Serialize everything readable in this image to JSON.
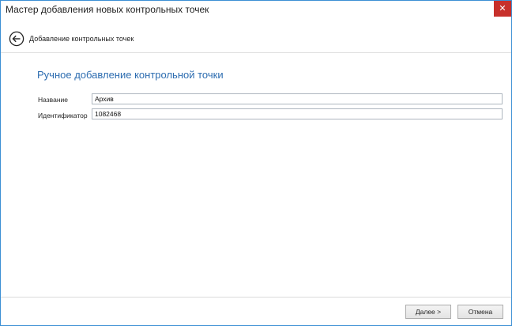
{
  "window": {
    "title": "Мастер добавления новых контрольных точек",
    "close_glyph": "✕"
  },
  "nav": {
    "back_icon": "back-arrow-circle-icon",
    "title": "Добавление контрольных точек"
  },
  "page": {
    "heading": "Ручное добавление контрольной точки"
  },
  "form": {
    "name_label": "Название",
    "name_value": "Архив",
    "id_label": "Идентификатор",
    "id_value": "1082468"
  },
  "footer": {
    "next_label": "Далее >",
    "cancel_label": "Отмена"
  },
  "colors": {
    "accent": "#2c6cb0",
    "close": "#c7302b",
    "border": "#3c8fd4"
  }
}
